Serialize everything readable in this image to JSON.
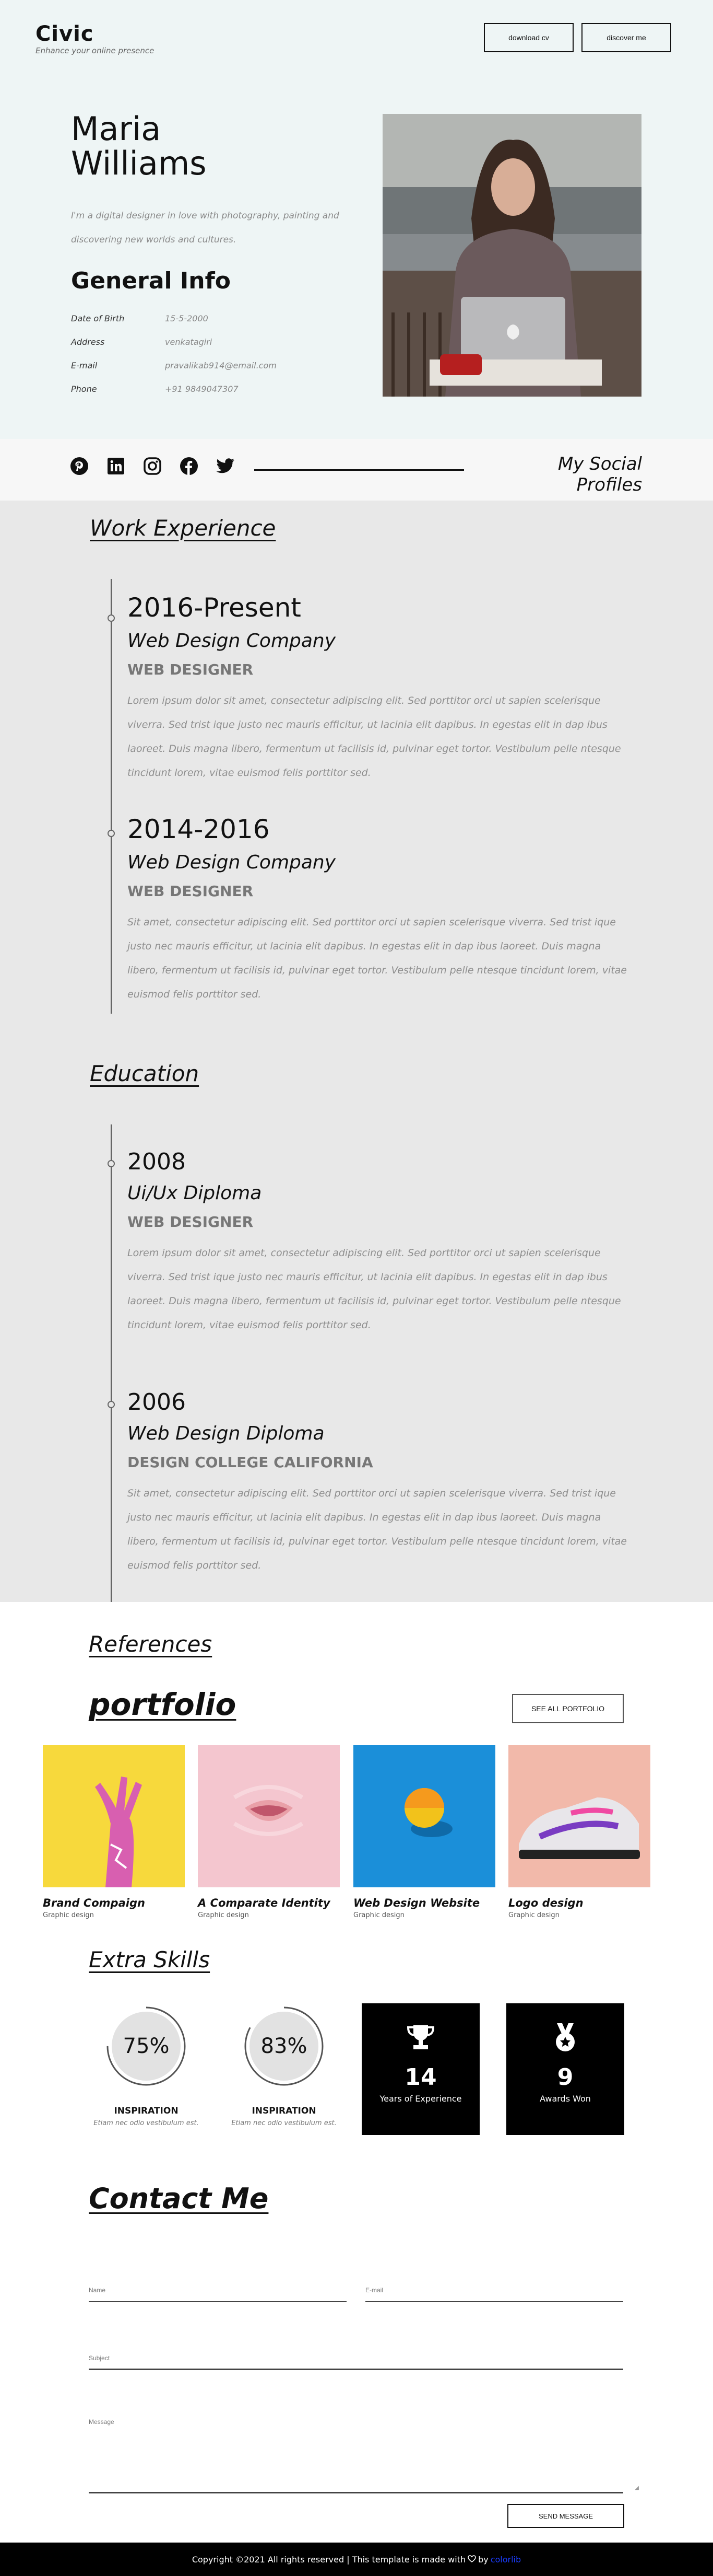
{
  "header": {
    "logo": "Civic",
    "tagline": "Enhance your online presence",
    "download_label": "download cv",
    "discover_label": "discover me"
  },
  "hero": {
    "first_name": "Maria",
    "last_name": "Williams",
    "intro": "I'm a digital designer in love with photography, painting and discovering new worlds and cultures.",
    "general_info_title": "General Info",
    "info": [
      {
        "label": "Date of Birth",
        "value": "15-5-2000"
      },
      {
        "label": "Address",
        "value": "venkatagiri"
      },
      {
        "label": "E-mail",
        "value": "pravalikab914@email.com"
      },
      {
        "label": "Phone",
        "value": "+91 9849047307"
      }
    ]
  },
  "social": {
    "title": "My Social Profiles",
    "icons": [
      "pinterest-icon",
      "linkedin-icon",
      "instagram-icon",
      "facebook-icon",
      "twitter-icon"
    ]
  },
  "work": {
    "title": "Work Experience",
    "entries": [
      {
        "year": "2016-Present",
        "company": "Web Design Company",
        "role": "WEB DESIGNER",
        "desc": "Lorem ipsum dolor sit amet, consectetur adipiscing elit. Sed porttitor orci ut sapien scelerisque viverra. Sed trist ique justo nec mauris efficitur, ut lacinia elit dapibus. In egestas elit in dap ibus laoreet. Duis magna libero, fermentum ut facilisis id, pulvinar eget tortor. Vestibulum pelle ntesque tincidunt lorem, vitae euismod felis porttitor sed."
      },
      {
        "year": "2014-2016",
        "company": "Web Design Company",
        "role": "WEB DESIGNER",
        "desc": "Sit amet, consectetur adipiscing elit. Sed porttitor orci ut sapien scelerisque viverra. Sed trist ique justo nec mauris efficitur, ut lacinia elit dapibus. In egestas elit in dap ibus laoreet. Duis magna libero, fermentum ut facilisis id, pulvinar eget tortor. Vestibulum pelle ntesque tincidunt lorem, vitae euismod felis porttitor sed."
      }
    ]
  },
  "education": {
    "title": "Education",
    "entries": [
      {
        "year": "2008",
        "school": "Ui/Ux Diploma",
        "role": "WEB DESIGNER",
        "desc": "Lorem ipsum dolor sit amet, consectetur adipiscing elit. Sed porttitor orci ut sapien scelerisque viverra. Sed trist ique justo nec mauris efficitur, ut lacinia elit dapibus. In egestas elit in dap ibus laoreet. Duis magna libero, fermentum ut facilisis id, pulvinar eget tortor. Vestibulum pelle ntesque tincidunt lorem, vitae euismod felis porttitor sed."
      },
      {
        "year": "2006",
        "school": "Web Design Diploma",
        "role": "DESIGN COLLEGE CALIFORNIA",
        "desc": "Sit amet, consectetur adipiscing elit. Sed porttitor orci ut sapien scelerisque viverra. Sed trist ique justo nec mauris efficitur, ut lacinia elit dapibus. In egestas elit in dap ibus laoreet. Duis magna libero, fermentum ut facilisis id, pulvinar eget tortor. Vestibulum pelle ntesque tincidunt lorem, vitae euismod felis porttitor sed."
      }
    ]
  },
  "references": {
    "title": "References"
  },
  "portfolio": {
    "title": "portfolio",
    "see_all_label": "SEE ALL PORTFOLIO",
    "items": [
      {
        "title": "Brand Compaign",
        "sub": "Graphic design",
        "bg": "#f7d93c"
      },
      {
        "title": "A Comparate Identity",
        "sub": "Graphic design",
        "bg": "#f4c6cf"
      },
      {
        "title": "Web Design Website",
        "sub": "Graphic design",
        "bg": "#1b8fd9"
      },
      {
        "title": "Logo design",
        "sub": "Graphic design",
        "bg": "#f2b9aa"
      }
    ]
  },
  "skills": {
    "title": "Extra Skills",
    "circles": [
      {
        "value": "75%",
        "percent": 75,
        "label": "INSPIRATION",
        "sub": "Etiam nec odio vestibulum est."
      },
      {
        "value": "83%",
        "percent": 83,
        "label": "INSPIRATION",
        "sub": "Etiam nec odio vestibulum est."
      }
    ],
    "stats": [
      {
        "icon": "trophy-icon",
        "number": "14",
        "label": "Years of Experience"
      },
      {
        "icon": "medal-icon",
        "number": "9",
        "label": "Awards Won"
      }
    ]
  },
  "contact": {
    "title": "Contact Me",
    "name_label": "Name",
    "email_label": "E-mail",
    "subject_label": "Subject",
    "message_label": "Message",
    "send_label": "SEND MESSAGE"
  },
  "footer": {
    "text_before": "Copyright ©2021 All rights reserved | This template is made with",
    "text_by": "by",
    "brand": "colorlib"
  }
}
